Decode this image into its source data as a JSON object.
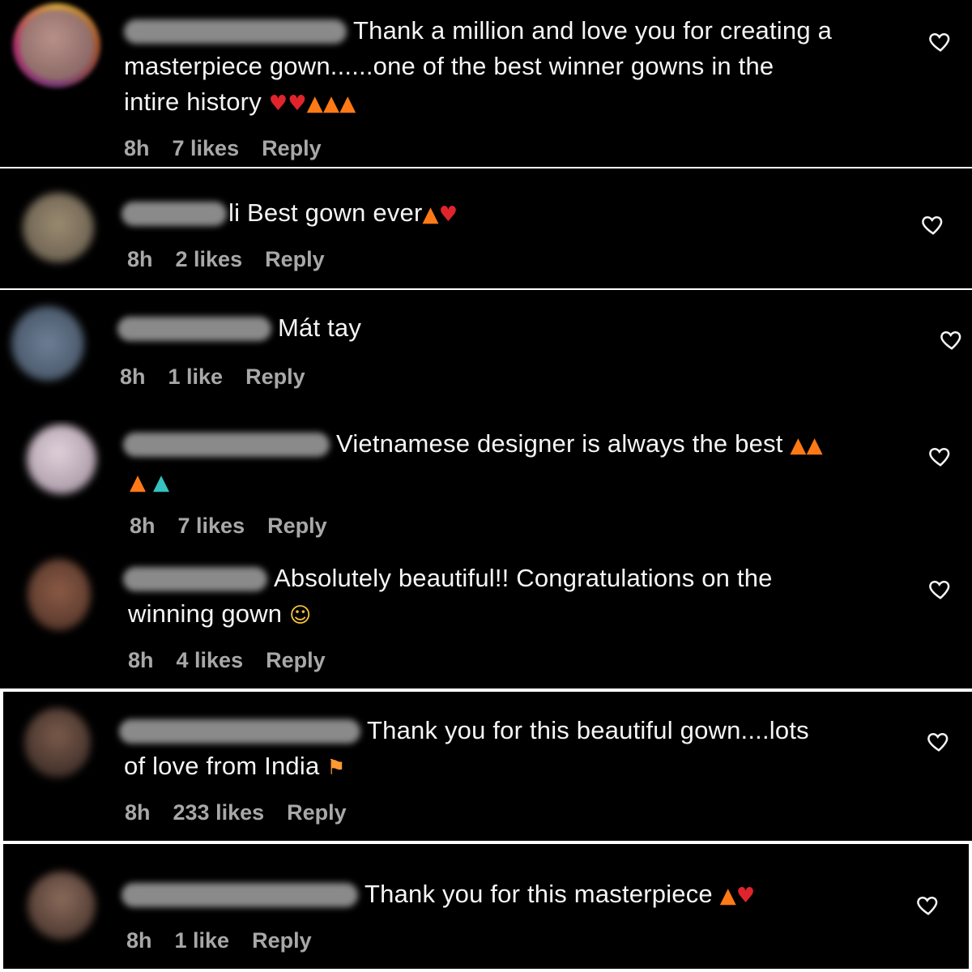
{
  "colors": {
    "background": "#000000",
    "text": "#f5f5f5",
    "meta_text": "#a8a8a8"
  },
  "comments": [
    {
      "text_lines": [
        "Thank a million and love you for creating a",
        "masterpiece gown......one of the best winner gowns in the",
        "intire history"
      ],
      "emojis": [
        "red-heart",
        "red-heart",
        "fire",
        "fire",
        "fire"
      ],
      "time": "8h",
      "likes": "7 likes",
      "reply": "Reply",
      "like_icon": "heart-outline-icon"
    },
    {
      "username_fragment": "li",
      "text_lines": [
        "Best gown ever"
      ],
      "emojis": [
        "fire",
        "red-heart"
      ],
      "time": "8h",
      "likes": "2 likes",
      "reply": "Reply",
      "like_icon": "heart-outline-icon"
    },
    {
      "text_lines": [
        "Mát tay"
      ],
      "time": "8h",
      "likes": "1 like",
      "reply": "Reply",
      "like_icon": "heart-outline-icon"
    },
    {
      "text_lines": [
        "Vietnamese designer is always the best"
      ],
      "emojis": [
        "fire",
        "fire",
        "fire",
        "dress"
      ],
      "time": "8h",
      "likes": "7 likes",
      "reply": "Reply",
      "like_icon": "heart-outline-icon"
    },
    {
      "text_lines": [
        "Absolutely beautiful!! Congratulations on the",
        "winning gown"
      ],
      "emojis": [
        "star-struck"
      ],
      "time": "8h",
      "likes": "4 likes",
      "reply": "Reply",
      "like_icon": "heart-outline-icon"
    },
    {
      "text_lines": [
        "Thank you for this beautiful gown....lots",
        "of love from India"
      ],
      "emojis": [
        "india-flag"
      ],
      "time": "8h",
      "likes": "233 likes",
      "reply": "Reply",
      "like_icon": "heart-outline-icon"
    },
    {
      "text_lines": [
        "Thank you for this masterpiece"
      ],
      "emojis": [
        "fire",
        "red-heart"
      ],
      "time": "8h",
      "likes": "1 like",
      "reply": "Reply",
      "like_icon": "heart-outline-icon"
    }
  ]
}
